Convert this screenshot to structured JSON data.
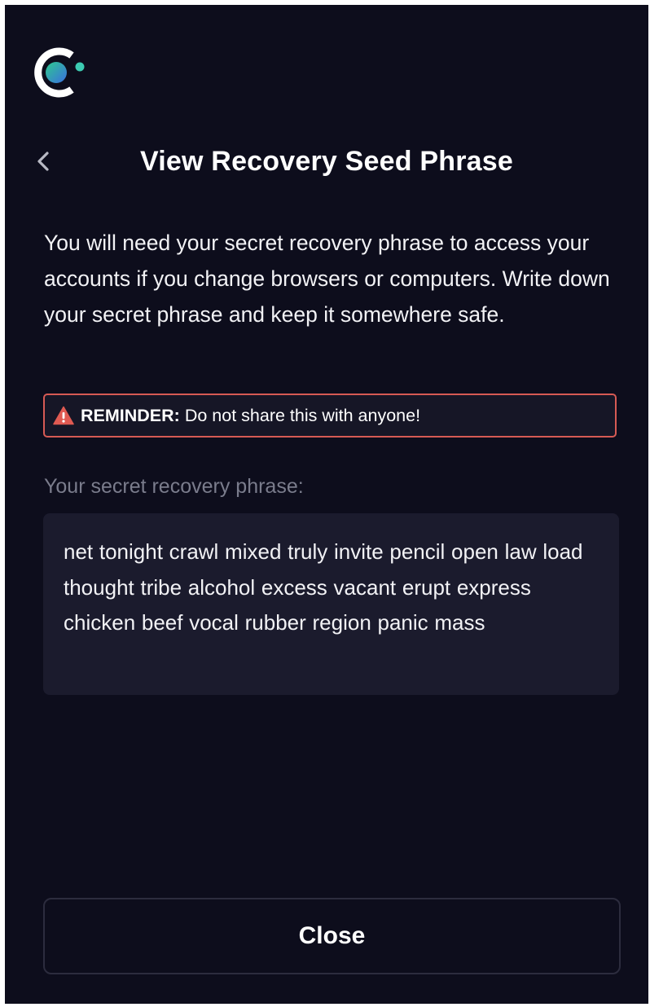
{
  "header": {
    "title": "View Recovery Seed Phrase",
    "back_icon": "chevron-left-icon"
  },
  "logo": {
    "icon": "celo-logo-icon",
    "colors": {
      "ring": "#ffffff",
      "dot": "#3ccbb2",
      "orb_gradient": [
        "#2ec98f",
        "#3a8fe6"
      ]
    }
  },
  "description": "You will need your secret recovery phrase to access your accounts if you change browsers or computers. Write down your secret phrase and keep it somewhere safe.",
  "reminder": {
    "icon": "warning-triangle-icon",
    "label": "REMINDER:",
    "text": "Do not share this with anyone!",
    "border_color": "#d65a54"
  },
  "phrase": {
    "label": "Your secret recovery phrase:",
    "value": "net tonight crawl mixed truly invite pencil open law load thought tribe alcohol excess vacant erupt express chicken beef vocal rubber region panic mass"
  },
  "close_button": {
    "label": "Close"
  },
  "colors": {
    "background": "#0d0d1c",
    "panel": "#1b1b2d",
    "text": "#ffffff",
    "muted_text": "#7a7c8c"
  }
}
